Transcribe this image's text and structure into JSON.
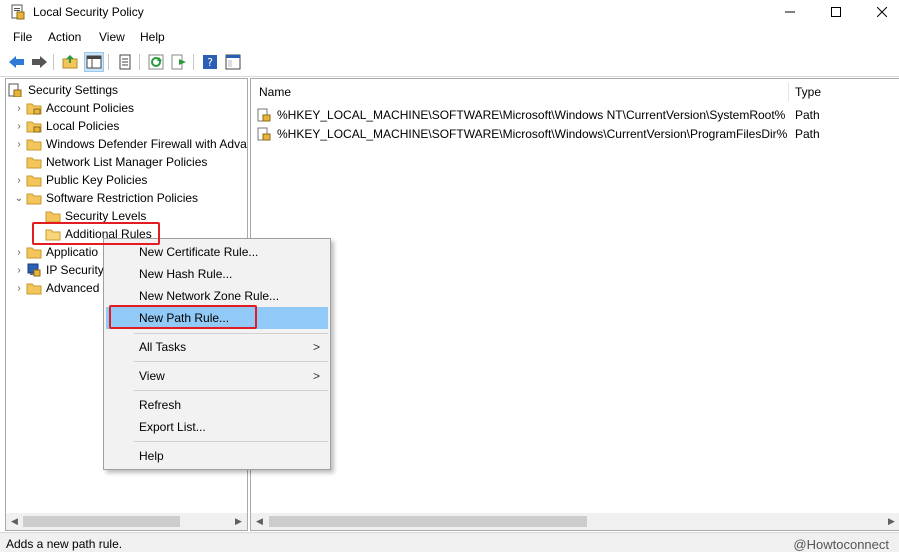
{
  "window": {
    "title": "Local Security Policy"
  },
  "menubar": [
    "File",
    "Action",
    "View",
    "Help"
  ],
  "toolbar_icons": [
    "back-arrow-icon",
    "forward-arrow-icon",
    "up-folder-icon",
    "show-hide-tree-icon",
    "properties-icon",
    "refresh-icon",
    "export-list-icon",
    "help-icon",
    "console-tree-icon"
  ],
  "tree": {
    "root": "Security Settings",
    "items": [
      {
        "label": "Account Policies"
      },
      {
        "label": "Local Policies"
      },
      {
        "label": "Windows Defender Firewall with Adva"
      },
      {
        "label": "Network List Manager Policies"
      },
      {
        "label": "Public Key Policies"
      },
      {
        "label": "Software Restriction Policies"
      },
      {
        "label": "Security Levels"
      },
      {
        "label": "Additional Rules"
      },
      {
        "label": "Applicatio"
      },
      {
        "label": "IP Security"
      },
      {
        "label": "Advanced"
      }
    ]
  },
  "list": {
    "columns": {
      "name": "Name",
      "type": "Type"
    },
    "rows": [
      {
        "name": "%HKEY_LOCAL_MACHINE\\SOFTWARE\\Microsoft\\Windows NT\\CurrentVersion\\SystemRoot%",
        "type": "Path"
      },
      {
        "name": "%HKEY_LOCAL_MACHINE\\SOFTWARE\\Microsoft\\Windows\\CurrentVersion\\ProgramFilesDir%",
        "type": "Path"
      }
    ]
  },
  "context_menu": {
    "items": [
      {
        "label": "New Certificate Rule..."
      },
      {
        "label": "New Hash Rule..."
      },
      {
        "label": "New Network Zone Rule..."
      },
      {
        "label": "New Path Rule..."
      },
      {
        "label": "All Tasks",
        "submenu": ">"
      },
      {
        "label": "View",
        "submenu": ">"
      },
      {
        "label": "Refresh"
      },
      {
        "label": "Export List..."
      },
      {
        "label": "Help"
      }
    ]
  },
  "status": {
    "text": "Adds a new path rule."
  },
  "watermark": "@Howtoconnect",
  "colors": {
    "highlight": "#91c9f7",
    "annotation_red": "#e31b23",
    "folder": "#f3c55a"
  }
}
